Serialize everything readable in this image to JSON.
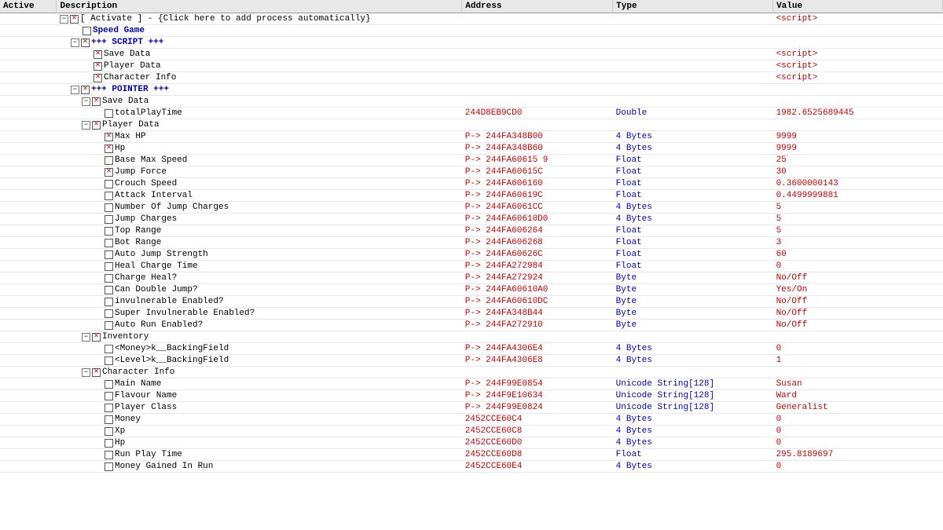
{
  "header": {
    "col_active": "Active",
    "col_desc": "Description",
    "col_addr": "Address",
    "col_type": "Type",
    "col_val": "Value"
  },
  "rows": [
    {
      "id": "r1",
      "indent": 0,
      "expand": true,
      "expanded": true,
      "cb": true,
      "desc": "[ Activate ] - {Click here to add process automatically}",
      "addr": "",
      "type": "",
      "val": "<script>",
      "valClass": "val-red",
      "descClass": ""
    },
    {
      "id": "r2",
      "indent": 1,
      "expand": false,
      "expanded": false,
      "cb": false,
      "desc": "Speed Game",
      "addr": "",
      "type": "",
      "val": "",
      "valClass": "",
      "descClass": ""
    },
    {
      "id": "r3",
      "indent": 1,
      "expand": true,
      "expanded": true,
      "cb": true,
      "desc": "+++ SCRIPT +++",
      "addr": "",
      "type": "",
      "val": "",
      "valClass": "",
      "descClass": "desc-red"
    },
    {
      "id": "r4",
      "indent": 2,
      "expand": false,
      "expanded": false,
      "cb": true,
      "desc": "Save Data",
      "addr": "",
      "type": "",
      "val": "<script>",
      "valClass": "val-red",
      "descClass": ""
    },
    {
      "id": "r5",
      "indent": 2,
      "expand": false,
      "expanded": false,
      "cb": true,
      "desc": "Player Data",
      "addr": "",
      "type": "",
      "val": "<script>",
      "valClass": "val-red",
      "descClass": ""
    },
    {
      "id": "r6",
      "indent": 2,
      "expand": false,
      "expanded": false,
      "cb": true,
      "desc": "Character Info",
      "addr": "",
      "type": "",
      "val": "<script>",
      "valClass": "val-red",
      "descClass": ""
    },
    {
      "id": "r7",
      "indent": 1,
      "expand": true,
      "expanded": true,
      "cb": true,
      "desc": "+++ POINTER +++",
      "addr": "",
      "type": "",
      "val": "",
      "valClass": "",
      "descClass": "desc-red"
    },
    {
      "id": "r8",
      "indent": 2,
      "expand": true,
      "expanded": true,
      "cb": true,
      "desc": "Save Data",
      "addr": "",
      "type": "",
      "val": "",
      "valClass": "",
      "descClass": ""
    },
    {
      "id": "r9",
      "indent": 3,
      "expand": false,
      "expanded": false,
      "cb": false,
      "desc": "totalPlayTime",
      "addr": "244D8EB9CD0",
      "type": "Double",
      "val": "1982.6525689445",
      "valClass": "val-red",
      "descClass": ""
    },
    {
      "id": "r10",
      "indent": 2,
      "expand": true,
      "expanded": true,
      "cb": true,
      "desc": "Player Data",
      "addr": "",
      "type": "",
      "val": "",
      "valClass": "",
      "descClass": ""
    },
    {
      "id": "r11",
      "indent": 3,
      "expand": false,
      "expanded": false,
      "cb": true,
      "desc": "Max HP",
      "addr": "P-> 244FA348B00",
      "type": "4 Bytes",
      "val": "9999",
      "valClass": "val-red",
      "descClass": ""
    },
    {
      "id": "r12",
      "indent": 3,
      "expand": false,
      "expanded": false,
      "cb": true,
      "desc": "Hp",
      "addr": "P-> 244FA348B60",
      "type": "4 Bytes",
      "val": "9999",
      "valClass": "val-red",
      "descClass": ""
    },
    {
      "id": "r13",
      "indent": 3,
      "expand": false,
      "expanded": false,
      "cb": false,
      "desc": "Base Max Speed",
      "addr": "P-> 244FA60615 9",
      "type": "Float",
      "val": "25",
      "valClass": "val-red",
      "descClass": ""
    },
    {
      "id": "r14",
      "indent": 3,
      "expand": false,
      "expanded": false,
      "cb": true,
      "desc": "Jump Force",
      "addr": "P-> 244FA60615C",
      "type": "Float",
      "val": "30",
      "valClass": "val-red",
      "descClass": ""
    },
    {
      "id": "r15",
      "indent": 3,
      "expand": false,
      "expanded": false,
      "cb": false,
      "desc": "Crouch Speed",
      "addr": "P-> 244FA606160",
      "type": "Float",
      "val": "0.3600000143",
      "valClass": "val-red",
      "descClass": ""
    },
    {
      "id": "r16",
      "indent": 3,
      "expand": false,
      "expanded": false,
      "cb": false,
      "desc": "Attack Interval",
      "addr": "P-> 244FA60619C",
      "type": "Float",
      "val": "0.4499999881",
      "valClass": "val-red",
      "descClass": ""
    },
    {
      "id": "r17",
      "indent": 3,
      "expand": false,
      "expanded": false,
      "cb": false,
      "desc": "Number Of Jump Charges",
      "addr": "P-> 244FA6061CC",
      "type": "4 Bytes",
      "val": "5",
      "valClass": "val-red",
      "descClass": ""
    },
    {
      "id": "r18",
      "indent": 3,
      "expand": false,
      "expanded": false,
      "cb": false,
      "desc": "Jump Charges",
      "addr": "P-> 244FA60610D0",
      "type": "4 Bytes",
      "val": "5",
      "valClass": "val-red",
      "descClass": ""
    },
    {
      "id": "r19",
      "indent": 3,
      "expand": false,
      "expanded": false,
      "cb": false,
      "desc": "Top Range",
      "addr": "P-> 244FA606264",
      "type": "Float",
      "val": "5",
      "valClass": "val-red",
      "descClass": ""
    },
    {
      "id": "r20",
      "indent": 3,
      "expand": false,
      "expanded": false,
      "cb": false,
      "desc": "Bot Range",
      "addr": "P-> 244FA606268",
      "type": "Float",
      "val": "3",
      "valClass": "val-red",
      "descClass": ""
    },
    {
      "id": "r21",
      "indent": 3,
      "expand": false,
      "expanded": false,
      "cb": false,
      "desc": "Auto Jump Strength",
      "addr": "P-> 244FA60626C",
      "type": "Float",
      "val": "60",
      "valClass": "val-red",
      "descClass": ""
    },
    {
      "id": "r22",
      "indent": 3,
      "expand": false,
      "expanded": false,
      "cb": false,
      "desc": "Heal Charge Time",
      "addr": "P-> 244FA272984",
      "type": "Float",
      "val": "0",
      "valClass": "val-red",
      "descClass": ""
    },
    {
      "id": "r23",
      "indent": 3,
      "expand": false,
      "expanded": false,
      "cb": false,
      "desc": "Charge Heal?",
      "addr": "P-> 244FA272924",
      "type": "Byte",
      "val": "No/Off",
      "valClass": "val-red",
      "descClass": ""
    },
    {
      "id": "r24",
      "indent": 3,
      "expand": false,
      "expanded": false,
      "cb": false,
      "desc": "Can Double Jump?",
      "addr": "P-> 244FA60610A0",
      "type": "Byte",
      "val": "Yes/On",
      "valClass": "val-red",
      "descClass": ""
    },
    {
      "id": "r25",
      "indent": 3,
      "expand": false,
      "expanded": false,
      "cb": false,
      "desc": "invulnerable Enabled?",
      "addr": "P-> 244FA60610DC",
      "type": "Byte",
      "val": "No/Off",
      "valClass": "val-red",
      "descClass": ""
    },
    {
      "id": "r26",
      "indent": 3,
      "expand": false,
      "expanded": false,
      "cb": false,
      "desc": "Super Invulnerable Enabled?",
      "addr": "P-> 244FA348B44",
      "type": "Byte",
      "val": "No/Off",
      "valClass": "val-red",
      "descClass": ""
    },
    {
      "id": "r27",
      "indent": 3,
      "expand": false,
      "expanded": false,
      "cb": false,
      "desc": "Auto Run Enabled?",
      "addr": "P-> 244FA272910",
      "type": "Byte",
      "val": "No/Off",
      "valClass": "val-red",
      "descClass": ""
    },
    {
      "id": "r28",
      "indent": 2,
      "expand": true,
      "expanded": true,
      "cb": true,
      "desc": "Inventory",
      "addr": "",
      "type": "",
      "val": "",
      "valClass": "",
      "descClass": ""
    },
    {
      "id": "r29",
      "indent": 3,
      "expand": false,
      "expanded": false,
      "cb": false,
      "desc": "<Money>k__BackingField",
      "addr": "P-> 244FA4306E4",
      "type": "4 Bytes",
      "val": "0",
      "valClass": "val-red",
      "descClass": ""
    },
    {
      "id": "r30",
      "indent": 3,
      "expand": false,
      "expanded": false,
      "cb": false,
      "desc": "<Level>k__BackingField",
      "addr": "P-> 244FA4306E8",
      "type": "4 Bytes",
      "val": "1",
      "valClass": "val-red",
      "descClass": ""
    },
    {
      "id": "r31",
      "indent": 2,
      "expand": true,
      "expanded": true,
      "cb": true,
      "desc": "Character Info",
      "addr": "",
      "type": "",
      "val": "",
      "valClass": "",
      "descClass": ""
    },
    {
      "id": "r32",
      "indent": 3,
      "expand": false,
      "expanded": false,
      "cb": false,
      "desc": "Main Name",
      "addr": "P-> 244F99E0854",
      "type": "Unicode String[128]",
      "val": "Susan",
      "valClass": "val-red",
      "descClass": ""
    },
    {
      "id": "r33",
      "indent": 3,
      "expand": false,
      "expanded": false,
      "cb": false,
      "desc": "Flavour Name",
      "addr": "P-> 244F9E10634",
      "type": "Unicode String[128]",
      "val": "Ward",
      "valClass": "val-red",
      "descClass": ""
    },
    {
      "id": "r34",
      "indent": 3,
      "expand": false,
      "expanded": false,
      "cb": false,
      "desc": "Player Class",
      "addr": "P-> 244F99E0824",
      "type": "Unicode String[128]",
      "val": "Generalist",
      "valClass": "val-red",
      "descClass": ""
    },
    {
      "id": "r35",
      "indent": 3,
      "expand": false,
      "expanded": false,
      "cb": false,
      "desc": "Money",
      "addr": "2452CCE60C4",
      "type": "4 Bytes",
      "val": "0",
      "valClass": "val-red",
      "descClass": ""
    },
    {
      "id": "r36",
      "indent": 3,
      "expand": false,
      "expanded": false,
      "cb": false,
      "desc": "Xp",
      "addr": "2452CCE60C8",
      "type": "4 Bytes",
      "val": "0",
      "valClass": "val-red",
      "descClass": ""
    },
    {
      "id": "r37",
      "indent": 3,
      "expand": false,
      "expanded": false,
      "cb": false,
      "desc": "Hp",
      "addr": "2452CCE60D0",
      "type": "4 Bytes",
      "val": "0",
      "valClass": "val-red",
      "descClass": ""
    },
    {
      "id": "r38",
      "indent": 3,
      "expand": false,
      "expanded": false,
      "cb": false,
      "desc": "Run Play Time",
      "addr": "2452CCE60D8",
      "type": "Float",
      "val": "295.8189697",
      "valClass": "val-red",
      "descClass": ""
    },
    {
      "id": "r39",
      "indent": 3,
      "expand": false,
      "expanded": false,
      "cb": false,
      "desc": "Money Gained In Run",
      "addr": "2452CCE60E4",
      "type": "4 Bytes",
      "val": "0",
      "valClass": "val-red",
      "descClass": ""
    }
  ]
}
